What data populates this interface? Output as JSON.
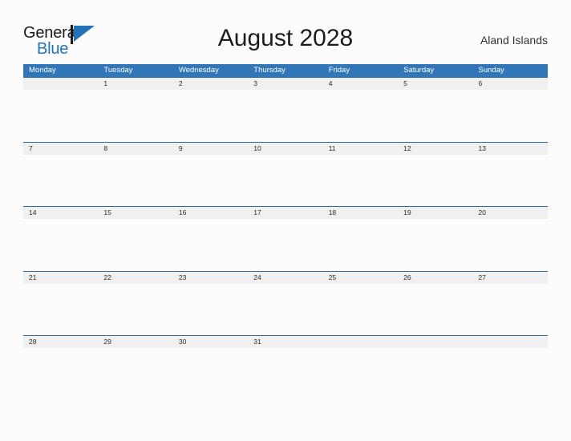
{
  "logo": {
    "text_top": "General",
    "text_bottom": "Blue",
    "mark": "triangle-flag",
    "color_top": "#1a1a1a",
    "color_bottom": "#2272b9",
    "mark_color": "#2272b9"
  },
  "header": {
    "title": "August 2028",
    "location": "Aland Islands"
  },
  "theme": {
    "header_blue": "#3177b7",
    "row_rule_blue": "#2e6da4",
    "band_gray": "#f0f0f0",
    "page_background": "#fcfcfc",
    "text_dark": "#2b2b2b"
  },
  "calendar": {
    "month": "August",
    "year": "2028",
    "weekday_headers": [
      "Monday",
      "Tuesday",
      "Wednesday",
      "Thursday",
      "Friday",
      "Saturday",
      "Sunday"
    ],
    "weeks": [
      [
        "",
        "1",
        "2",
        "3",
        "4",
        "5",
        "6"
      ],
      [
        "7",
        "8",
        "9",
        "10",
        "11",
        "12",
        "13"
      ],
      [
        "14",
        "15",
        "16",
        "17",
        "18",
        "19",
        "20"
      ],
      [
        "21",
        "22",
        "23",
        "24",
        "25",
        "26",
        "27"
      ],
      [
        "28",
        "29",
        "30",
        "31",
        "",
        "",
        ""
      ]
    ]
  }
}
